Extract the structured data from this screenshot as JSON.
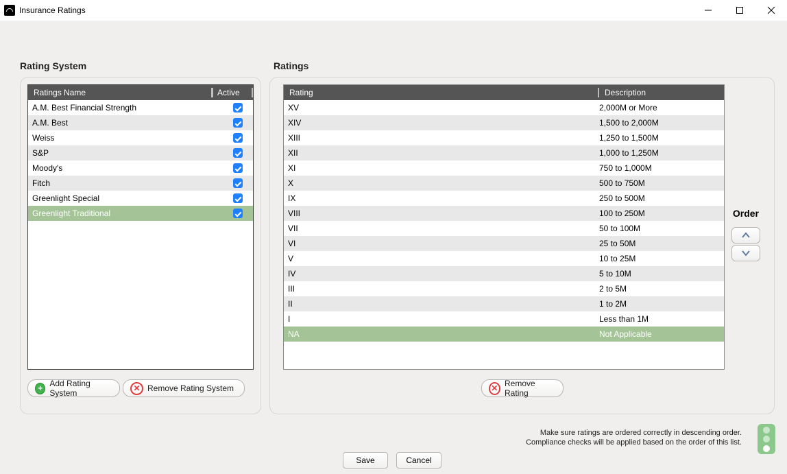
{
  "window": {
    "title": "Insurance Ratings"
  },
  "group_labels": {
    "rating_system": "Rating System",
    "ratings": "Ratings",
    "order": "Order"
  },
  "ratings_systems": {
    "headers": {
      "name": "Ratings Name",
      "active": "Active"
    },
    "rows": [
      {
        "name": "A.M. Best Financial Strength",
        "active": true,
        "selected": false
      },
      {
        "name": "A.M. Best",
        "active": true,
        "selected": false
      },
      {
        "name": "Weiss",
        "active": true,
        "selected": false
      },
      {
        "name": "S&P",
        "active": true,
        "selected": false
      },
      {
        "name": "Moody's",
        "active": true,
        "selected": false
      },
      {
        "name": "Fitch",
        "active": true,
        "selected": false
      },
      {
        "name": "Greenlight Special",
        "active": true,
        "selected": false
      },
      {
        "name": "Greenlight Traditional",
        "active": true,
        "selected": true
      }
    ]
  },
  "ratings": {
    "headers": {
      "rating": "Rating",
      "description": "Description"
    },
    "rows": [
      {
        "rating": "XV",
        "description": "2,000M or More",
        "selected": false
      },
      {
        "rating": "XIV",
        "description": "1,500 to 2,000M",
        "selected": false
      },
      {
        "rating": "XIII",
        "description": "1,250 to 1,500M",
        "selected": false
      },
      {
        "rating": "XII",
        "description": "1,000 to 1,250M",
        "selected": false
      },
      {
        "rating": "XI",
        "description": "750 to 1,000M",
        "selected": false
      },
      {
        "rating": "X",
        "description": "500 to 750M",
        "selected": false
      },
      {
        "rating": "IX",
        "description": "250 to 500M",
        "selected": false
      },
      {
        "rating": "VIII",
        "description": "100 to 250M",
        "selected": false
      },
      {
        "rating": "VII",
        "description": "50 to 100M",
        "selected": false
      },
      {
        "rating": "VI",
        "description": "25 to 50M",
        "selected": false
      },
      {
        "rating": "V",
        "description": "10 to 25M",
        "selected": false
      },
      {
        "rating": "IV",
        "description": "5 to 10M",
        "selected": false
      },
      {
        "rating": "III",
        "description": "2 to 5M",
        "selected": false
      },
      {
        "rating": "II",
        "description": "1 to 2M",
        "selected": false
      },
      {
        "rating": "I",
        "description": "Less than 1M",
        "selected": false
      },
      {
        "rating": "NA",
        "description": "Not Applicable",
        "selected": true
      }
    ]
  },
  "buttons": {
    "add_rs": "Add Rating System",
    "remove_rs": "Remove Rating System",
    "remove_rating": "Remove Rating",
    "save": "Save",
    "cancel": "Cancel"
  },
  "hint": {
    "line1": "Make sure ratings are ordered correctly in descending order.",
    "line2": "Compliance checks will be applied based on the order of this list."
  }
}
